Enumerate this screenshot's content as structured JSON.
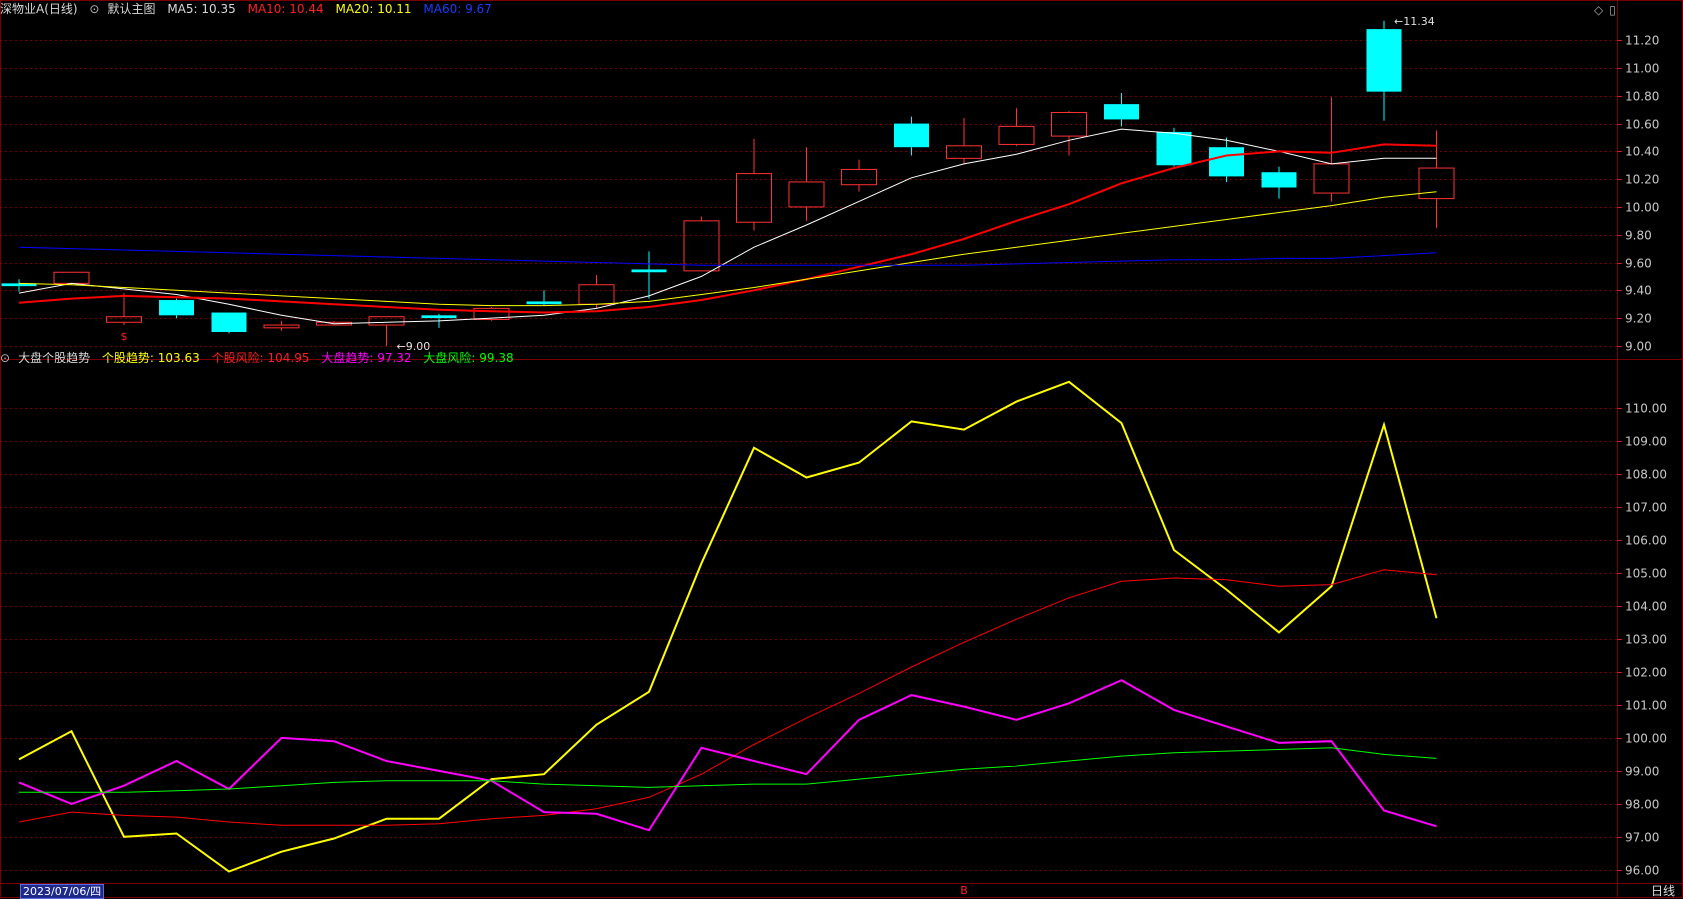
{
  "header_main": {
    "stock_name": "深物业A",
    "period_label": "(日线)",
    "template": "默认主图",
    "ma5_label": "MA5:",
    "ma5_value": "10.35",
    "ma10_label": "MA10:",
    "ma10_value": "10.44",
    "ma20_label": "MA20:",
    "ma20_value": "10.11",
    "ma60_label": "MA60:",
    "ma60_value": "9.67"
  },
  "header_sub": {
    "indicator_name": "大盘个股趋势",
    "s1_label": "个股趋势:",
    "s1_value": "103.63",
    "s2_label": "个股风险:",
    "s2_value": "104.95",
    "s3_label": "大盘趋势:",
    "s3_value": "97.32",
    "s4_label": "大盘风险:",
    "s4_value": "99.38"
  },
  "footer": {
    "date": "2023/07/06/四",
    "period": "日线"
  },
  "colors": {
    "bg": "#000000",
    "grid": "#7a0000",
    "up": "#ff3232",
    "down": "#00ffff",
    "ma5": "#ffffff",
    "ma10": "#ff0000",
    "ma20": "#ffff00",
    "ma60": "#0000ff",
    "trend": "#ffff00",
    "risk": "#ff0000",
    "market_trend": "#ff00ff",
    "market_risk": "#00ff00"
  },
  "chart_data": [
    {
      "type": "candlestick",
      "y_ticks": [
        "9.00",
        "9.20",
        "9.40",
        "9.60",
        "9.80",
        "10.00",
        "10.20",
        "10.40",
        "10.60",
        "10.80",
        "11.00",
        "11.20"
      ],
      "ylim": [
        8.92,
        11.36
      ],
      "candles": [
        {
          "o": 9.45,
          "h": 9.48,
          "l": 9.39,
          "c": 9.43
        },
        {
          "o": 9.45,
          "h": 9.53,
          "l": 9.44,
          "c": 9.53
        },
        {
          "o": 9.17,
          "h": 9.38,
          "l": 9.15,
          "c": 9.21
        },
        {
          "o": 9.33,
          "h": 9.34,
          "l": 9.2,
          "c": 9.22
        },
        {
          "o": 9.24,
          "h": 9.24,
          "l": 9.09,
          "c": 9.1
        },
        {
          "o": 9.13,
          "h": 9.18,
          "l": 9.11,
          "c": 9.15
        },
        {
          "o": 9.15,
          "h": 9.18,
          "l": 9.15,
          "c": 9.17
        },
        {
          "o": 9.15,
          "h": 9.21,
          "l": 9.0,
          "c": 9.21
        },
        {
          "o": 9.22,
          "h": 9.23,
          "l": 9.13,
          "c": 9.2
        },
        {
          "o": 9.19,
          "h": 9.28,
          "l": 9.18,
          "c": 9.27
        },
        {
          "o": 9.32,
          "h": 9.4,
          "l": 9.29,
          "c": 9.3
        },
        {
          "o": 9.3,
          "h": 9.51,
          "l": 9.27,
          "c": 9.44
        },
        {
          "o": 9.55,
          "h": 9.68,
          "l": 9.34,
          "c": 9.53
        },
        {
          "o": 9.54,
          "h": 9.93,
          "l": 9.54,
          "c": 9.9
        },
        {
          "o": 9.89,
          "h": 10.49,
          "l": 9.83,
          "c": 10.24
        },
        {
          "o": 10.0,
          "h": 10.43,
          "l": 9.9,
          "c": 10.18
        },
        {
          "o": 10.16,
          "h": 10.34,
          "l": 10.11,
          "c": 10.27
        },
        {
          "o": 10.6,
          "h": 10.65,
          "l": 10.37,
          "c": 10.43
        },
        {
          "o": 10.35,
          "h": 10.64,
          "l": 10.31,
          "c": 10.44
        },
        {
          "o": 10.45,
          "h": 10.71,
          "l": 10.44,
          "c": 10.58
        },
        {
          "o": 10.51,
          "h": 10.69,
          "l": 10.37,
          "c": 10.68
        },
        {
          "o": 10.74,
          "h": 10.82,
          "l": 10.58,
          "c": 10.63
        },
        {
          "o": 10.54,
          "h": 10.57,
          "l": 10.29,
          "c": 10.3
        },
        {
          "o": 10.43,
          "h": 10.5,
          "l": 10.18,
          "c": 10.22
        },
        {
          "o": 10.25,
          "h": 10.29,
          "l": 10.06,
          "c": 10.14
        },
        {
          "o": 10.1,
          "h": 10.79,
          "l": 10.04,
          "c": 10.31
        },
        {
          "o": 11.28,
          "h": 11.34,
          "l": 10.62,
          "c": 10.83
        },
        {
          "o": 10.06,
          "h": 10.55,
          "l": 9.85,
          "c": 10.28
        }
      ],
      "series": [
        {
          "name": "MA5",
          "values": [
            9.38,
            9.45,
            9.41,
            9.37,
            9.3,
            9.22,
            9.16,
            9.17,
            9.18,
            9.2,
            9.22,
            9.27,
            9.36,
            9.5,
            9.71,
            9.87,
            10.04,
            10.21,
            10.31,
            10.38,
            10.48,
            10.56,
            10.53,
            10.48,
            10.4,
            10.31,
            10.35,
            10.35
          ]
        },
        {
          "name": "MA10",
          "values": [
            9.31,
            9.34,
            9.36,
            9.35,
            9.34,
            9.32,
            9.3,
            9.28,
            9.26,
            9.25,
            9.24,
            9.25,
            9.28,
            9.33,
            9.4,
            9.48,
            9.57,
            9.66,
            9.77,
            9.9,
            10.02,
            10.17,
            10.28,
            10.37,
            10.4,
            10.39,
            10.45,
            10.44
          ]
        },
        {
          "name": "MA20",
          "values": [
            9.45,
            9.44,
            9.42,
            9.4,
            9.38,
            9.36,
            9.34,
            9.32,
            9.3,
            9.29,
            9.29,
            9.3,
            9.32,
            9.37,
            9.42,
            9.48,
            9.54,
            9.6,
            9.66,
            9.71,
            9.76,
            9.81,
            9.86,
            9.91,
            9.96,
            10.01,
            10.07,
            10.11
          ]
        },
        {
          "name": "MA60",
          "values": [
            9.71,
            9.7,
            9.69,
            9.68,
            9.67,
            9.66,
            9.65,
            9.64,
            9.63,
            9.62,
            9.61,
            9.6,
            9.59,
            9.58,
            9.58,
            9.58,
            9.58,
            9.58,
            9.58,
            9.59,
            9.6,
            9.61,
            9.62,
            9.62,
            9.63,
            9.63,
            9.65,
            9.67
          ]
        }
      ],
      "annotations": [
        {
          "text": "9.00",
          "candle": 7,
          "value": 9.0
        },
        {
          "text": "11.34",
          "candle": 26,
          "value": 11.34
        }
      ],
      "markers": [
        {
          "text": "$",
          "candle": 2
        },
        {
          "text": "B",
          "candle": 18
        }
      ]
    },
    {
      "type": "line",
      "y_ticks": [
        "96.00",
        "97.00",
        "98.00",
        "99.00",
        "100.00",
        "101.00",
        "102.00",
        "103.00",
        "104.00",
        "105.00",
        "106.00",
        "107.00",
        "108.00",
        "109.00",
        "110.00"
      ],
      "ylim": [
        95.6,
        111.25
      ],
      "series": [
        {
          "name": "个股趋势",
          "values": [
            99.35,
            100.2,
            97.0,
            97.1,
            95.95,
            96.55,
            96.95,
            97.55,
            97.55,
            98.75,
            98.9,
            100.4,
            101.4,
            105.3,
            108.8,
            107.9,
            108.35,
            109.6,
            109.35,
            110.2,
            110.8,
            109.55,
            105.7,
            104.5,
            103.2,
            104.6,
            109.5,
            103.63
          ]
        },
        {
          "name": "个股风险",
          "values": [
            97.45,
            97.75,
            97.65,
            97.6,
            97.45,
            97.35,
            97.35,
            97.35,
            97.4,
            97.55,
            97.65,
            97.85,
            98.2,
            98.9,
            99.8,
            100.6,
            101.35,
            102.15,
            102.9,
            103.6,
            104.25,
            104.75,
            104.85,
            104.8,
            104.6,
            104.65,
            105.1,
            104.95
          ]
        },
        {
          "name": "大盘趋势",
          "values": [
            98.65,
            98.0,
            98.55,
            99.3,
            98.45,
            100.0,
            99.9,
            99.3,
            99.0,
            98.7,
            97.75,
            97.7,
            97.2,
            99.7,
            99.3,
            98.9,
            100.55,
            101.3,
            100.95,
            100.55,
            101.05,
            101.75,
            100.85,
            100.35,
            99.85,
            99.9,
            97.8,
            97.32
          ]
        },
        {
          "name": "大盘风险",
          "values": [
            98.35,
            98.35,
            98.35,
            98.4,
            98.45,
            98.55,
            98.65,
            98.7,
            98.7,
            98.7,
            98.6,
            98.55,
            98.5,
            98.55,
            98.6,
            98.6,
            98.75,
            98.9,
            99.05,
            99.15,
            99.3,
            99.45,
            99.55,
            99.6,
            99.65,
            99.7,
            99.5,
            99.38
          ]
        }
      ]
    }
  ]
}
